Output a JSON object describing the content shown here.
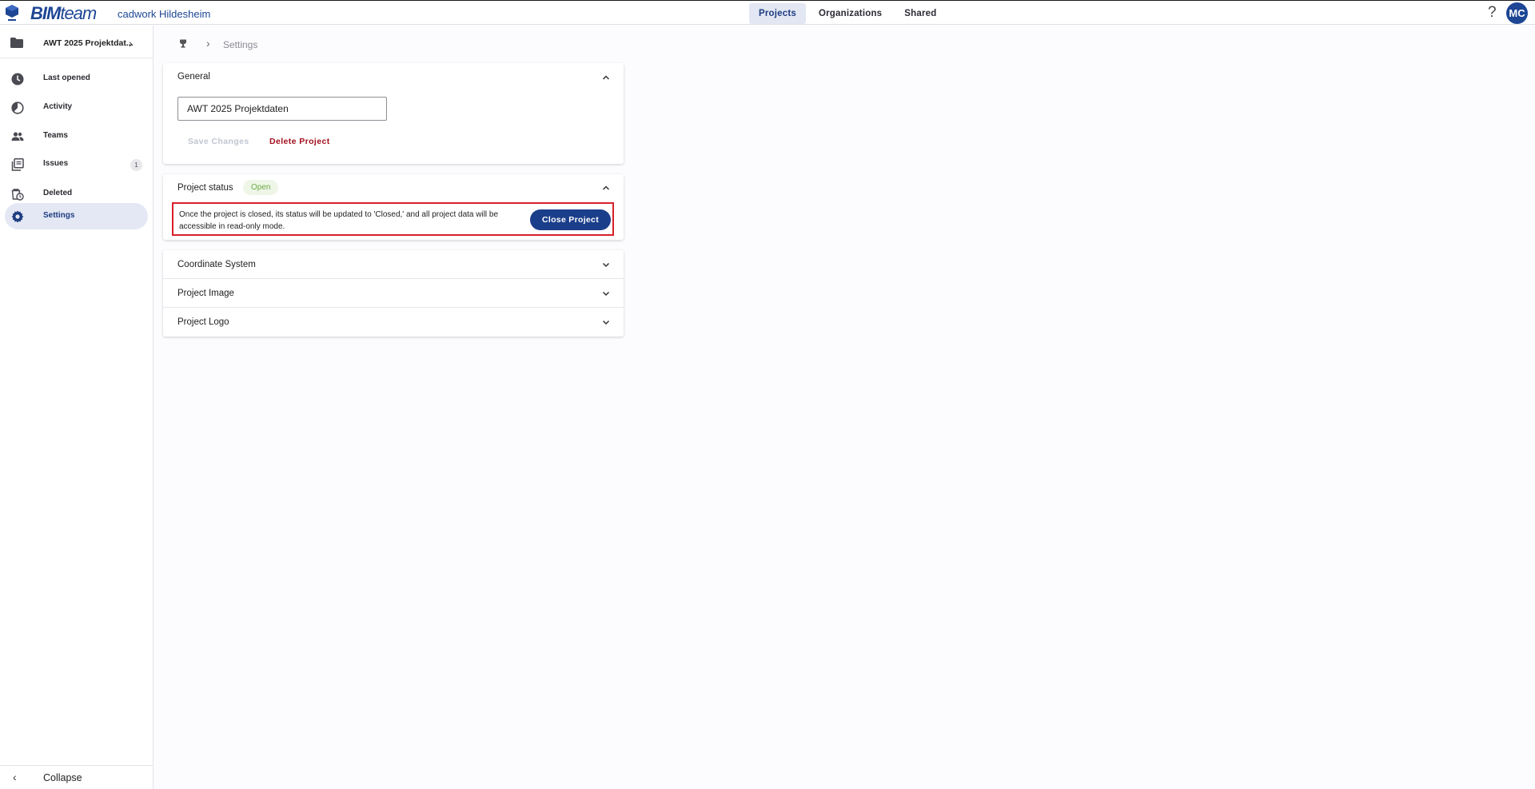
{
  "header": {
    "brand_strong": "BIM",
    "brand_light": "team",
    "org_name": "cadwork Hildesheim",
    "nav": [
      {
        "label": "Projects",
        "active": true
      },
      {
        "label": "Organizations",
        "active": false
      },
      {
        "label": "Shared",
        "active": false
      }
    ],
    "help_label": "?",
    "avatar_initials": "MC",
    "accent_color": "#1d4694"
  },
  "sidebar": {
    "project_label": "AWT 2025 Projektdat...",
    "items": [
      {
        "label": "Last opened",
        "icon": "clock-icon"
      },
      {
        "label": "Activity",
        "icon": "activity-icon"
      },
      {
        "label": "Teams",
        "icon": "people-icon"
      },
      {
        "label": "Issues",
        "icon": "issues-icon",
        "badge": "1"
      },
      {
        "label": "Deleted",
        "icon": "deleted-icon"
      },
      {
        "label": "Settings",
        "icon": "gear-icon",
        "active": true
      }
    ],
    "collapse_label": "Collapse"
  },
  "breadcrumb": {
    "current": "Settings"
  },
  "general": {
    "title": "General",
    "project_name_value": "AWT 2025 Projektdaten",
    "save_label": "Save Changes",
    "delete_label": "Delete Project"
  },
  "project_status": {
    "title": "Project status",
    "status": "Open",
    "message": "Once the project is closed, its status will be updated to 'Closed,' and all project data will be accessible in read-only mode.",
    "close_label": "Close Project"
  },
  "sections": [
    {
      "title": "Coordinate System"
    },
    {
      "title": "Project Image"
    },
    {
      "title": "Project Logo"
    }
  ]
}
